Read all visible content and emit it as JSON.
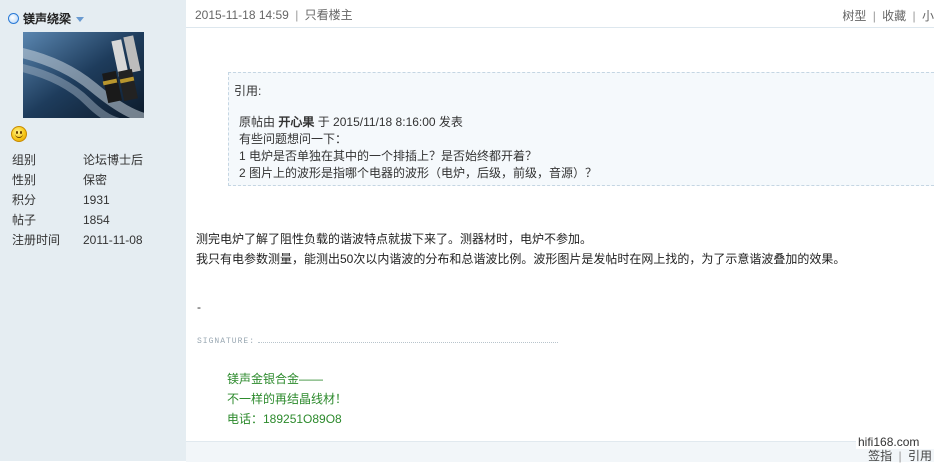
{
  "author": {
    "name": "镁声绕梁"
  },
  "stats": [
    {
      "label": "组别",
      "value": "论坛博士后"
    },
    {
      "label": "性别",
      "value": "保密"
    },
    {
      "label": "积分",
      "value": "1931"
    },
    {
      "label": "帖子",
      "value": "1854"
    },
    {
      "label": "注册时间",
      "value": "2011-11-08"
    }
  ],
  "topbar": {
    "post_time": "2015-11-18 14:59",
    "separator": "|",
    "only_op": "只看楼主",
    "actions": [
      "树型",
      "收藏",
      "小"
    ]
  },
  "quote": {
    "title": "引用:",
    "original_prefix": "原帖由",
    "original_author": "开心果",
    "original_suffix": "于 2015/11/18 8:16:00 发表",
    "lines": [
      "有些问题想问一下：",
      "1 电炉是否单独在其中的一个排插上？是否始终都开着？",
      "2 图片上的波形是指哪个电器的波形（电炉，后级，前级，音源）？"
    ]
  },
  "body": {
    "lines": [
      "测完电炉了解了阻性负载的谐波特点就拔下来了。测器材时，电炉不参加。",
      "我只有电参数测量，能测出50次以内谐波的分布和总谐波比例。波形图片是发帖时在网上找的，为了示意谐波叠加的效果。"
    ],
    "dash": "-"
  },
  "signature": {
    "label": "SIGNATURE:",
    "lines": [
      "镁声金银合金——",
      "不一样的再结晶线材！",
      "电话：189251O89O8"
    ]
  },
  "bottom": {
    "actions": [
      "签指",
      "引用"
    ],
    "separator": "|"
  },
  "watermark": "hifi168.com",
  "colors": {
    "sidebar_bg": "#e5edf2",
    "quote_bg": "#f5f9fc",
    "signature": "#2c8a2c"
  }
}
